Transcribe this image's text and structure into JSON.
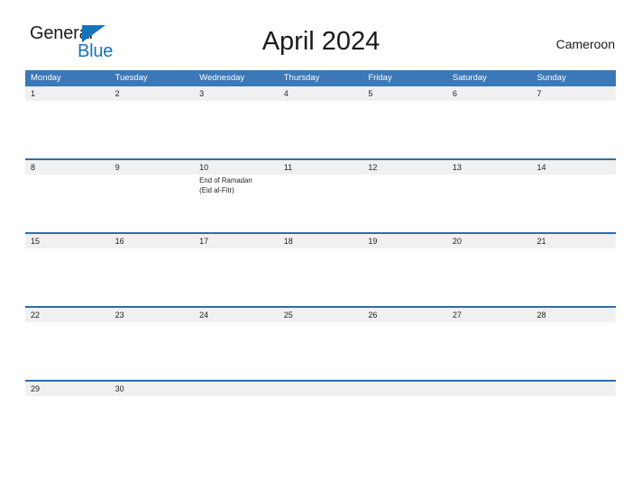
{
  "logo": {
    "word1": "General",
    "word2": "Blue",
    "triangle_icon": "triangle-icon",
    "brand_color": "#1573bb"
  },
  "header": {
    "title": "April 2024",
    "country": "Cameroon"
  },
  "theme": {
    "header_blue": "#3b78b8",
    "row_line_blue": "#2c6ca8",
    "band_gray": "#f0f0f0",
    "text_dark": "#1a1a1a"
  },
  "calendar": {
    "weekdays": [
      "Monday",
      "Tuesday",
      "Wednesday",
      "Thursday",
      "Friday",
      "Saturday",
      "Sunday"
    ],
    "weeks": [
      {
        "days": [
          {
            "date": "1",
            "events": []
          },
          {
            "date": "2",
            "events": []
          },
          {
            "date": "3",
            "events": []
          },
          {
            "date": "4",
            "events": []
          },
          {
            "date": "5",
            "events": []
          },
          {
            "date": "6",
            "events": []
          },
          {
            "date": "7",
            "events": []
          }
        ]
      },
      {
        "days": [
          {
            "date": "8",
            "events": []
          },
          {
            "date": "9",
            "events": []
          },
          {
            "date": "10",
            "events": [
              "End of Ramadan",
              "(Eid al-Fitr)"
            ]
          },
          {
            "date": "11",
            "events": []
          },
          {
            "date": "12",
            "events": []
          },
          {
            "date": "13",
            "events": []
          },
          {
            "date": "14",
            "events": []
          }
        ]
      },
      {
        "days": [
          {
            "date": "15",
            "events": []
          },
          {
            "date": "16",
            "events": []
          },
          {
            "date": "17",
            "events": []
          },
          {
            "date": "18",
            "events": []
          },
          {
            "date": "19",
            "events": []
          },
          {
            "date": "20",
            "events": []
          },
          {
            "date": "21",
            "events": []
          }
        ]
      },
      {
        "days": [
          {
            "date": "22",
            "events": []
          },
          {
            "date": "23",
            "events": []
          },
          {
            "date": "24",
            "events": []
          },
          {
            "date": "25",
            "events": []
          },
          {
            "date": "26",
            "events": []
          },
          {
            "date": "27",
            "events": []
          },
          {
            "date": "28",
            "events": []
          }
        ]
      },
      {
        "days": [
          {
            "date": "29",
            "events": []
          },
          {
            "date": "30",
            "events": []
          },
          {
            "date": "",
            "events": []
          },
          {
            "date": "",
            "events": []
          },
          {
            "date": "",
            "events": []
          },
          {
            "date": "",
            "events": []
          },
          {
            "date": "",
            "events": []
          }
        ]
      }
    ]
  }
}
